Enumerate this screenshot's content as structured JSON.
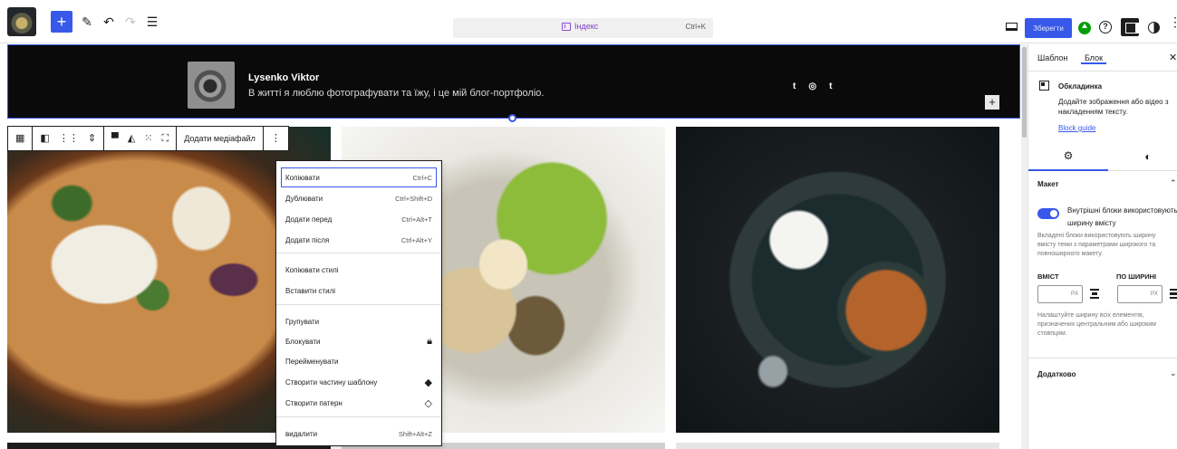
{
  "toolbar": {
    "add_icon": "plus-icon",
    "command": {
      "title": "Індекс",
      "shortcut": "Ctrl+K"
    },
    "save_label": "Зберегти"
  },
  "header": {
    "site_name": "Lysenko Viktor",
    "tagline": "В житті я люблю фотографувати та їжу, і це мій блог-портфоліо.",
    "social_icons": [
      "t",
      "◎",
      "t"
    ]
  },
  "block_toolbar": {
    "add_media_label": "Додати медіафайл"
  },
  "context_menu": {
    "items": [
      {
        "label": "Копіювати",
        "shortcut": "Ctrl+C",
        "icon": ""
      },
      {
        "label": "Дублювати",
        "shortcut": "Ctrl+Shift+D",
        "icon": ""
      },
      {
        "label": "Додати перед",
        "shortcut": "Ctrl+Alt+T",
        "icon": ""
      },
      {
        "label": "Додати після",
        "shortcut": "Ctrl+Alt+Y",
        "icon": ""
      },
      {
        "label": "Копіювати стилі",
        "shortcut": "",
        "icon": ""
      },
      {
        "label": "Вставити стилі",
        "shortcut": "",
        "icon": ""
      },
      {
        "label": "Групувати",
        "shortcut": "",
        "icon": ""
      },
      {
        "label": "Блокувати",
        "shortcut": "",
        "icon": "lock-icon"
      },
      {
        "label": "Перейменувати",
        "shortcut": "",
        "icon": ""
      },
      {
        "label": "Створити частину шаблону",
        "shortcut": "",
        "icon": "template-part-icon"
      },
      {
        "label": "Створити патерн",
        "shortcut": "",
        "icon": "pattern-icon"
      },
      {
        "label": "видалити",
        "shortcut": "Shift+Alt+Z",
        "icon": ""
      }
    ]
  },
  "sidebar": {
    "tabs": [
      "Шаблон",
      "Блок"
    ],
    "active_tab": "Блок",
    "block": {
      "title": "Обкладинка",
      "description": "Додайте зображення або відео з накладенням тексту.",
      "guide_link": "Block guide"
    },
    "layout": {
      "heading": "Макет",
      "toggle_label": "Внутрішні блоки використовують ширину вмісту",
      "toggle_on": true,
      "toggle_help": "Вкладені блоки використовують ширину вмісту теми з параметрами широкого та повноширного макету.",
      "content_label": "ВМІСТ",
      "wide_label": "ПО ШИРИНІ",
      "content_unit": "PX",
      "wide_unit": "PX",
      "width_help": "Налаштуйте ширину всіх елементів, призначених центральним або широким стовпцям."
    },
    "advanced": {
      "heading": "Додатково"
    }
  },
  "colors": {
    "accent": "#3858e9",
    "header_bg": "#0a0a0a",
    "pattern_purple": "#7a3ec4"
  }
}
